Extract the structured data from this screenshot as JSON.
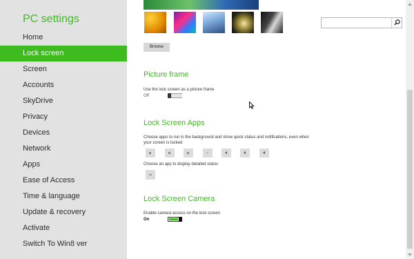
{
  "sidebar": {
    "title": "PC settings",
    "items": [
      {
        "label": "Home"
      },
      {
        "label": "Lock screen"
      },
      {
        "label": "Screen"
      },
      {
        "label": "Accounts"
      },
      {
        "label": "SkyDrive"
      },
      {
        "label": "Privacy"
      },
      {
        "label": "Devices"
      },
      {
        "label": "Network"
      },
      {
        "label": "Apps"
      },
      {
        "label": "Ease of Access"
      },
      {
        "label": "Time & language"
      },
      {
        "label": "Update & recovery"
      },
      {
        "label": "Activate"
      },
      {
        "label": "Switch To Win8 ver"
      }
    ],
    "active_index": 1
  },
  "search": {
    "placeholder": "",
    "value": ""
  },
  "background": {
    "browse_label": "Browse",
    "thumbnails": [
      "honeycomb",
      "colorful-lines",
      "glass-tunnel",
      "nautilus-shell",
      "piano-keys"
    ]
  },
  "picture_frame": {
    "heading": "Picture frame",
    "description": "Use the lock screen as a picture frame",
    "toggle_state": "Off"
  },
  "lock_screen_apps": {
    "heading": "Lock Screen Apps",
    "description": "Choose apps to run in the background and show quick status and notifications, even when your screen is locked",
    "slots": 7,
    "detail_label": "Choose an app to display detailed status"
  },
  "lock_screen_camera": {
    "heading": "Lock Screen Camera",
    "description": "Enable camera access on the lock screen",
    "toggle_state": "On"
  },
  "colors": {
    "accent": "#3dbb1f",
    "sidebar_bg": "#e2e2e2"
  }
}
